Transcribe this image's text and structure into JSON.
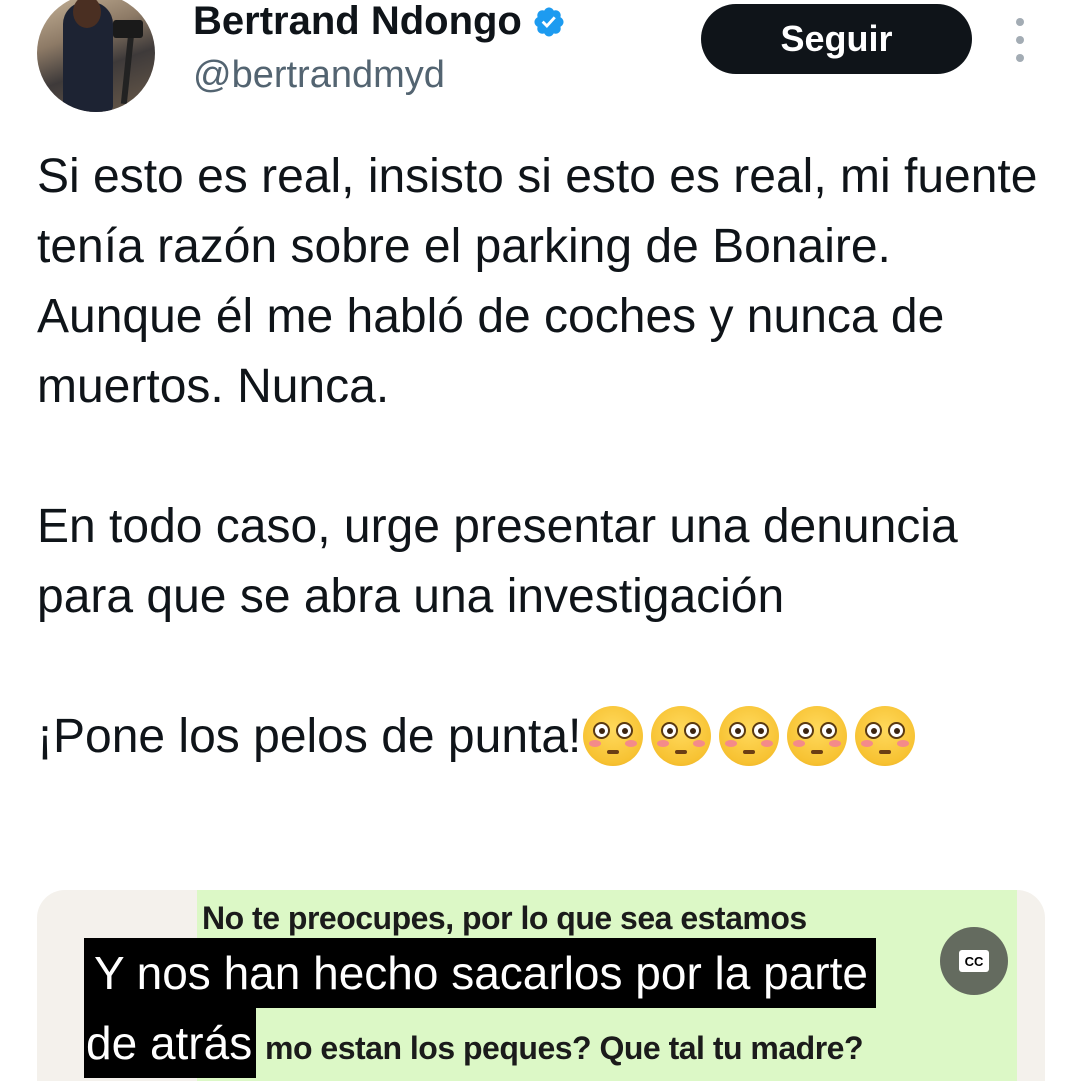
{
  "author": {
    "display_name": "Bertrand Ndongo",
    "handle": "@bertrandmyd",
    "avatar_icon": "profile-photo",
    "verified_icon": "verified-badge-icon",
    "verified_color": "#1d9bf0"
  },
  "actions": {
    "follow_label": "Seguir",
    "more_icon": "more-vertical-icon"
  },
  "tweet": {
    "paragraph_1": "Si esto es real, insisto si esto es real, mi fuente tenía razón sobre el parking de Bonaire. Aunque él me habló de coches y nunca de muertos. Nunca.",
    "paragraph_2": "En todo caso, urge presentar una denuncia para que se abra una investigación",
    "paragraph_3": "¡Pone los pelos de punta!",
    "emoji_name": "flushed-face",
    "emoji_count": 5
  },
  "media": {
    "chat_top_line": "No te preocupes, por lo que sea estamos",
    "chat_bottom_line": "mo estan los peques? Que tal tu madre?",
    "caption_line_1": "Y nos han hecho sacarlos por la parte",
    "caption_line_2": "de atrás",
    "cc_label": "CC"
  }
}
